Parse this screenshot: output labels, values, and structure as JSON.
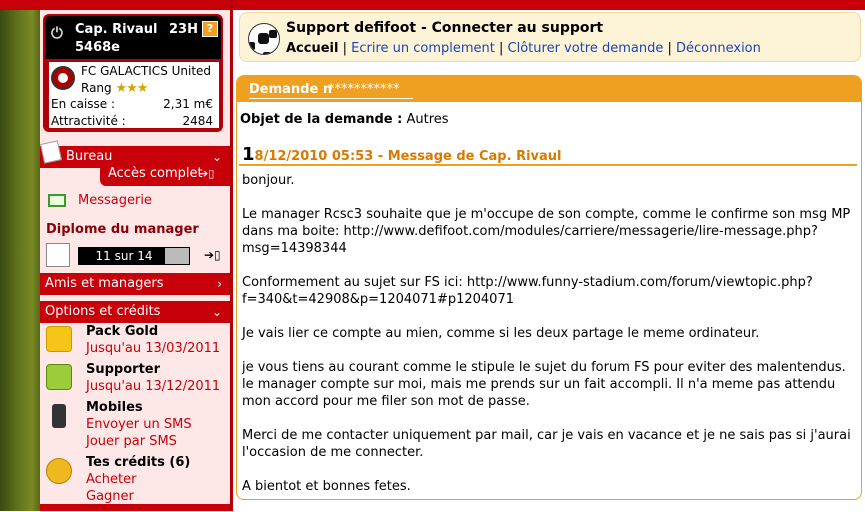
{
  "player": {
    "name": "Cap. Rivaul",
    "hour": "23H",
    "money": "5468e",
    "club": "FC GALACTICS United",
    "rank_label": "Rang",
    "rank_stars": "★★★",
    "caisse_label": "En caisse :",
    "caisse_value": "2,31 m€",
    "attract_label": "Attractivité :",
    "attract_value": "2484"
  },
  "sidebar": {
    "bureau": "Bureau",
    "acces_complet": "Accès complet",
    "messagerie": "Messagerie",
    "diploma_title": "Diplome du manager",
    "diploma_progress": "11 sur 14",
    "diploma_fraction": 0.786,
    "amis": "Amis et managers",
    "options": "Options et crédits",
    "pack_gold": "Pack Gold",
    "pack_gold_until": "Jusqu'au 13/03/2011",
    "supporter": "Supporter",
    "supporter_until": "Jusqu'au 13/12/2011",
    "mobiles": "Mobiles",
    "envoyer_sms": "Envoyer un SMS",
    "jouer_sms": "Jouer par SMS",
    "credits": "Tes crédits (6)",
    "acheter": "Acheter",
    "gagner": "Gagner"
  },
  "support": {
    "title": "Support defifoot - Connecter au support",
    "nav": {
      "accueil": "Accueil",
      "ecrire": "Ecrire un complement",
      "cloturer": "Clôturer votre demande",
      "deconnexion": "Déconnexion"
    }
  },
  "request": {
    "header": "Demande n",
    "header_stars": "***********",
    "object_label": "Objet de la demande :",
    "object_value": "Autres",
    "msg_num": "1",
    "msg_header": "8/12/2010 05:53 - Message de Cap. Rivaul",
    "body": [
      "bonjour.",
      "Le manager Rcsc3 souhaite que je m'occupe de son compte, comme le confirme son msg MP dans ma boite: http://www.defifoot.com/modules/carriere/messagerie/lire-message.php?msg=14398344",
      "Conformement au sujet sur FS ici: http://www.funny-stadium.com/forum/viewtopic.php?f=340&t=42908&p=1204071#p1204071",
      "Je vais lier ce compte au mien, comme si les deux partage le meme ordinateur.",
      "je vous tiens au courant comme le stipule le sujet du forum FS pour eviter des malentendus.",
      "le manager compte sur moi, mais me prends sur un fait accompli. Il n'a meme pas attendu mon accord pour me filer son mot de passe.",
      "Merci de me contacter uniquement par mail, car je vais en vacance et je ne sais pas si j'aurai l'occasion de me connecter.",
      "A bientot et bonnes fetes."
    ]
  },
  "colors": {
    "red": "#c8000a",
    "orange": "#f0a020",
    "link": "#1a44b8"
  }
}
